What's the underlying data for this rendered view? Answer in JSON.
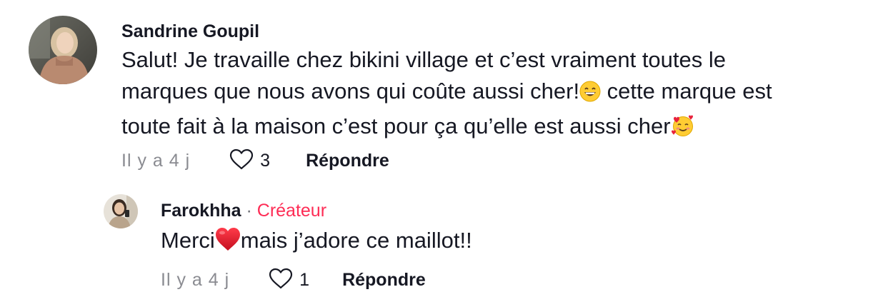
{
  "comments": [
    {
      "author": "Sandrine Goupil",
      "text_line1": "Salut! Je travaille chez bikini village et c’est vraiment toutes le",
      "text_line2a": "marques que nous avons qui coûte aussi cher!",
      "text_line2b": " cette marque est",
      "text_line3a": "toute fait à la maison c’est pour ça qu’elle est aussi cher",
      "emoji_1": "grinning-face-emoji",
      "emoji_2": "smiling-face-with-hearts-emoji",
      "time": "Il y a 4 j",
      "likes": "3",
      "reply_label": "Répondre"
    }
  ],
  "reply": {
    "author": "Farokhha",
    "separator": "·",
    "badge": "Créateur",
    "text_a": "Merci",
    "text_b": "mais j’adore ce maillot!!",
    "emoji": "red-heart-emoji",
    "time": "Il y a 4 j",
    "likes": "1",
    "reply_label": "Répondre"
  },
  "colors": {
    "creator_badge": "#fe2c55",
    "meta_text": "#8a8b91",
    "primary_text": "#161823"
  }
}
